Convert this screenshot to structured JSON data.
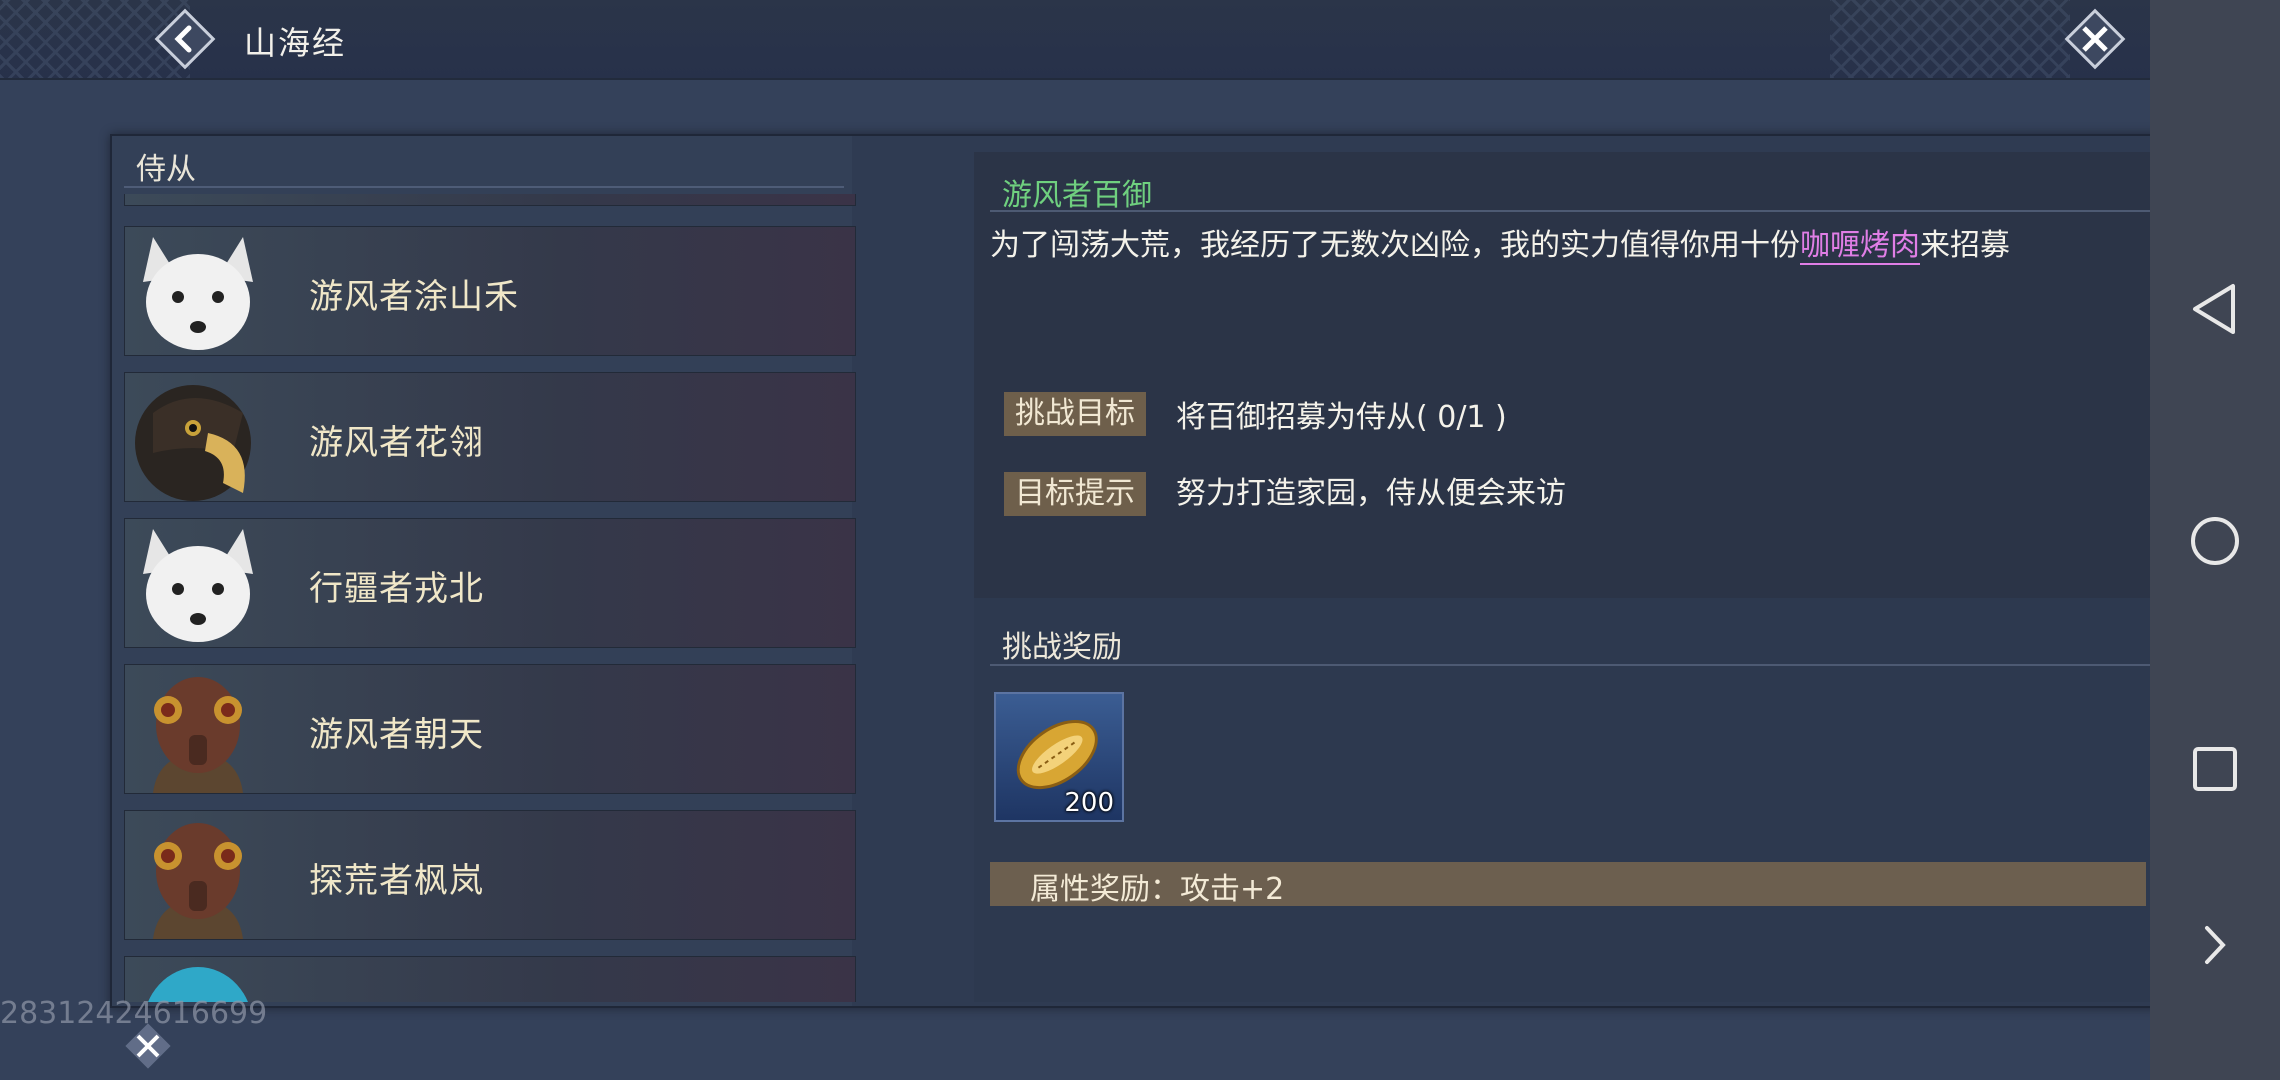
{
  "header": {
    "title": "山海经"
  },
  "list": {
    "title": "侍从",
    "items": [
      {
        "name": "游风者涂山禾",
        "avatar": "white-fox-icon"
      },
      {
        "name": "游风者花翎",
        "avatar": "eagle-icon"
      },
      {
        "name": "行疆者戎北",
        "avatar": "white-fox-icon"
      },
      {
        "name": "游风者朝天",
        "avatar": "fly-mask-icon"
      },
      {
        "name": "探荒者枫岚",
        "avatar": "fly-mask-icon"
      }
    ]
  },
  "detail": {
    "npc_name": "游风者百御",
    "quote_before": "为了闯荡大荒，我经历了无数次凶险，我的实力值得你用十份",
    "quote_highlight": "咖喱烤肉",
    "quote_after": "来招募",
    "goal_label": "挑战目标",
    "goal_text": "将百御招募为侍从( 0/1 )",
    "hint_label": "目标提示",
    "hint_text": "努力打造家园，侍从便会来访",
    "reward_title": "挑战奖励",
    "reward_item": {
      "icon": "golden-seed-icon",
      "count": "200"
    },
    "attr_reward": "属性奖励：攻击+2"
  },
  "footer": {
    "uid": "2831242461669​9"
  },
  "colors": {
    "npc_name": "#6fd07f",
    "highlight": "#e07ee6",
    "tag_bg": "#6e5f4b"
  }
}
